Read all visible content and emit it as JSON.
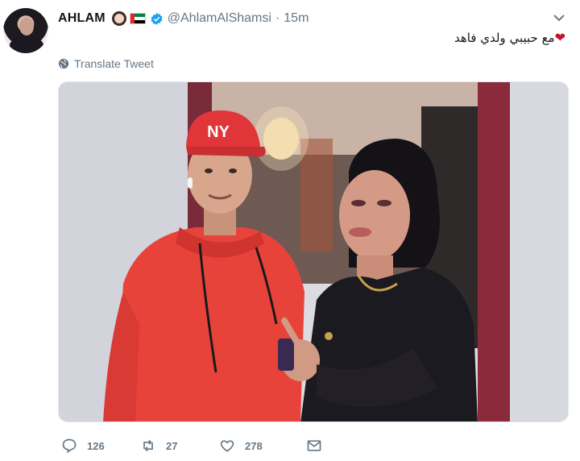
{
  "tweet": {
    "display_name": "AHLAM",
    "handle": "@AhlamAlShamsi",
    "separator": "·",
    "time": "15m",
    "text": "مع حبيبي ولدي فاهد",
    "heart_emoji": "❤",
    "translate_label": "Translate Tweet",
    "badges": [
      "woman-emoji",
      "uae-flag-emoji",
      "verified-icon"
    ]
  },
  "photo": {
    "hat_logo": "NY"
  },
  "actions": {
    "replies": "126",
    "retweets": "27",
    "likes": "278"
  },
  "colors": {
    "text": "#14171a",
    "secondary": "#657786",
    "verified": "#1da1f2",
    "heart": "#c4122f"
  },
  "icons": [
    "chevron-down-icon",
    "globe-icon",
    "reply-icon",
    "retweet-icon",
    "heart-icon",
    "message-icon"
  ]
}
